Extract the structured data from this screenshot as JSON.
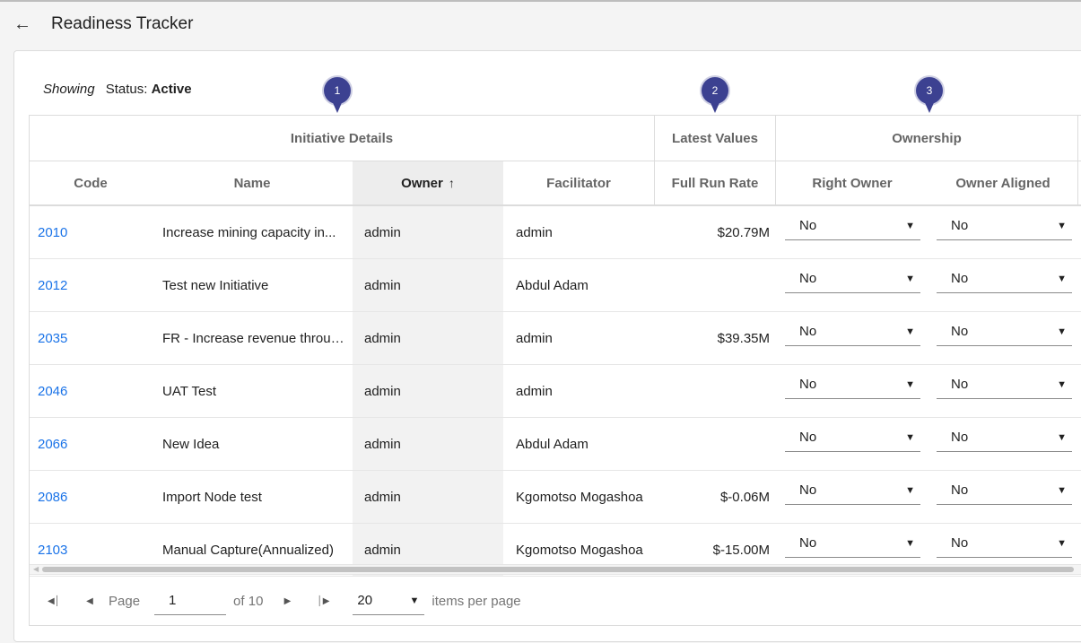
{
  "header": {
    "back_icon": "arrow-left-icon",
    "title": "Readiness Tracker"
  },
  "filter": {
    "showing_label": "Showing",
    "status_label": "Status:",
    "status_value": "Active"
  },
  "group_headers": [
    "Initiative Details",
    "Latest Values",
    "Ownership"
  ],
  "columns": [
    "Code",
    "Name",
    "Owner",
    "Facilitator",
    "Full Run Rate",
    "Right Owner",
    "Owner Aligned"
  ],
  "sort": {
    "column": "Owner",
    "direction_icon": "arrow-up-icon"
  },
  "pins": [
    "1",
    "2",
    "3"
  ],
  "rows": [
    {
      "code": "2010",
      "name": "Increase mining capacity in...",
      "owner": "admin",
      "facilitator": "admin",
      "run_rate": "$20.79M",
      "right_owner": "No",
      "owner_aligned": "No"
    },
    {
      "code": "2012",
      "name": "Test new Initiative",
      "owner": "admin",
      "facilitator": "Abdul Adam",
      "run_rate": "",
      "right_owner": "No",
      "owner_aligned": "No"
    },
    {
      "code": "2035",
      "name": "FR - Increase revenue through...",
      "owner": "admin",
      "facilitator": "admin",
      "run_rate": "$39.35M",
      "right_owner": "No",
      "owner_aligned": "No"
    },
    {
      "code": "2046",
      "name": "UAT Test",
      "owner": "admin",
      "facilitator": "admin",
      "run_rate": "",
      "right_owner": "No",
      "owner_aligned": "No"
    },
    {
      "code": "2066",
      "name": "New Idea",
      "owner": "admin",
      "facilitator": "Abdul Adam",
      "run_rate": "",
      "right_owner": "No",
      "owner_aligned": "No"
    },
    {
      "code": "2086",
      "name": "Import Node test",
      "owner": "admin",
      "facilitator": "Kgomotso Mogashoa",
      "run_rate": "$-0.06M",
      "right_owner": "No",
      "owner_aligned": "No"
    },
    {
      "code": "2103",
      "name": "Manual Capture(Annualized)",
      "owner": "admin",
      "facilitator": "Kgomotso Mogashoa",
      "run_rate": "$-15.00M",
      "right_owner": "No",
      "owner_aligned": "No"
    }
  ],
  "pager": {
    "page_label": "Page",
    "page_value": "1",
    "of_label": "of 10",
    "page_size": "20",
    "items_label": "items per page"
  },
  "colors": {
    "link": "#1a73e8",
    "pin": "#3c4191",
    "sorted_bg": "#f2f2f2"
  }
}
